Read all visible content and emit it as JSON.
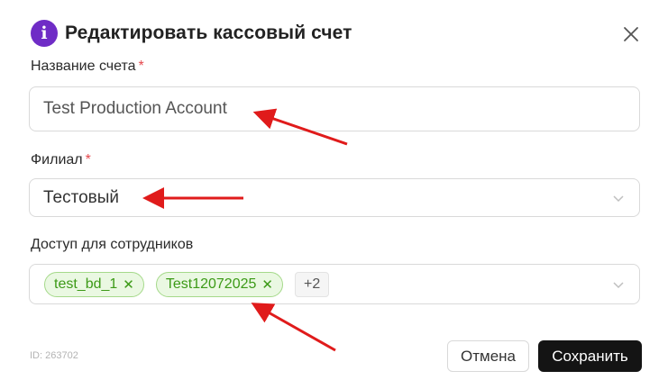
{
  "dialog": {
    "title": "Редактировать кассовый счет",
    "info_icon_glyph": "i",
    "close_icon": "close-icon"
  },
  "fields": {
    "account_name": {
      "label": "Название счета",
      "required_mark": "*",
      "value": "Test Production Account"
    },
    "branch": {
      "label": "Филиал",
      "required_mark": "*",
      "value": "Тестовый"
    },
    "employee_access": {
      "label": "Доступ для сотрудников",
      "tags": [
        {
          "label": "test_bd_1",
          "remove": "✕"
        },
        {
          "label": "Test12072025",
          "remove": "✕"
        }
      ],
      "more_count": "+2"
    }
  },
  "footer": {
    "id_text": "ID: 263702",
    "cancel_label": "Отмена",
    "save_label": "Сохранить"
  },
  "colors": {
    "info_icon": "#6f2cc6",
    "required": "#e5484d",
    "tag_text": "#3c9a17",
    "tag_bg": "#eaf8e2",
    "save_button": "#141414",
    "annotation_arrow": "#e01b1b"
  }
}
